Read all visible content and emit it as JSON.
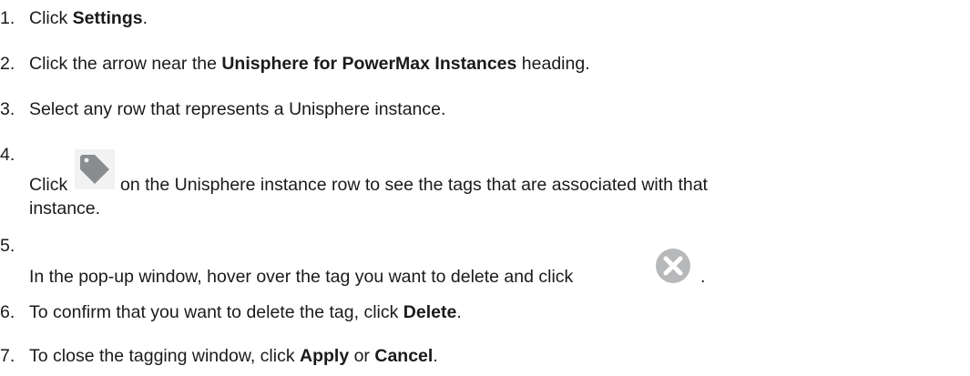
{
  "steps": [
    {
      "number": "1.",
      "parts": [
        "Click ",
        "Settings",
        "."
      ]
    },
    {
      "number": "2.",
      "parts": [
        "Click the arrow near the ",
        "Unisphere for PowerMax Instances",
        " heading."
      ]
    },
    {
      "number": "3.",
      "text": "Select any row that represents a Unisphere instance."
    },
    {
      "number": "4.",
      "before_icon": "Click",
      "after_icon": "on the Unisphere instance row to see the tags that are associated with that",
      "continuation": "instance.",
      "icon": "tag-icon"
    },
    {
      "number": "5.",
      "text": "In the pop-up window, hover over the tag you want to delete and click",
      "after_icon": ".",
      "icon": "delete-circle-x-icon"
    },
    {
      "number": "6.",
      "parts": [
        "To confirm that you want to delete the tag, click ",
        "Delete",
        "."
      ]
    },
    {
      "number": "7.",
      "parts": [
        "To close the tagging window, click ",
        "Apply",
        " or ",
        "Cancel",
        "."
      ]
    }
  ],
  "colors": {
    "text": "#1a1a1a",
    "tag_icon": "#8a8d90",
    "delete_icon": "#b7b8ba"
  }
}
